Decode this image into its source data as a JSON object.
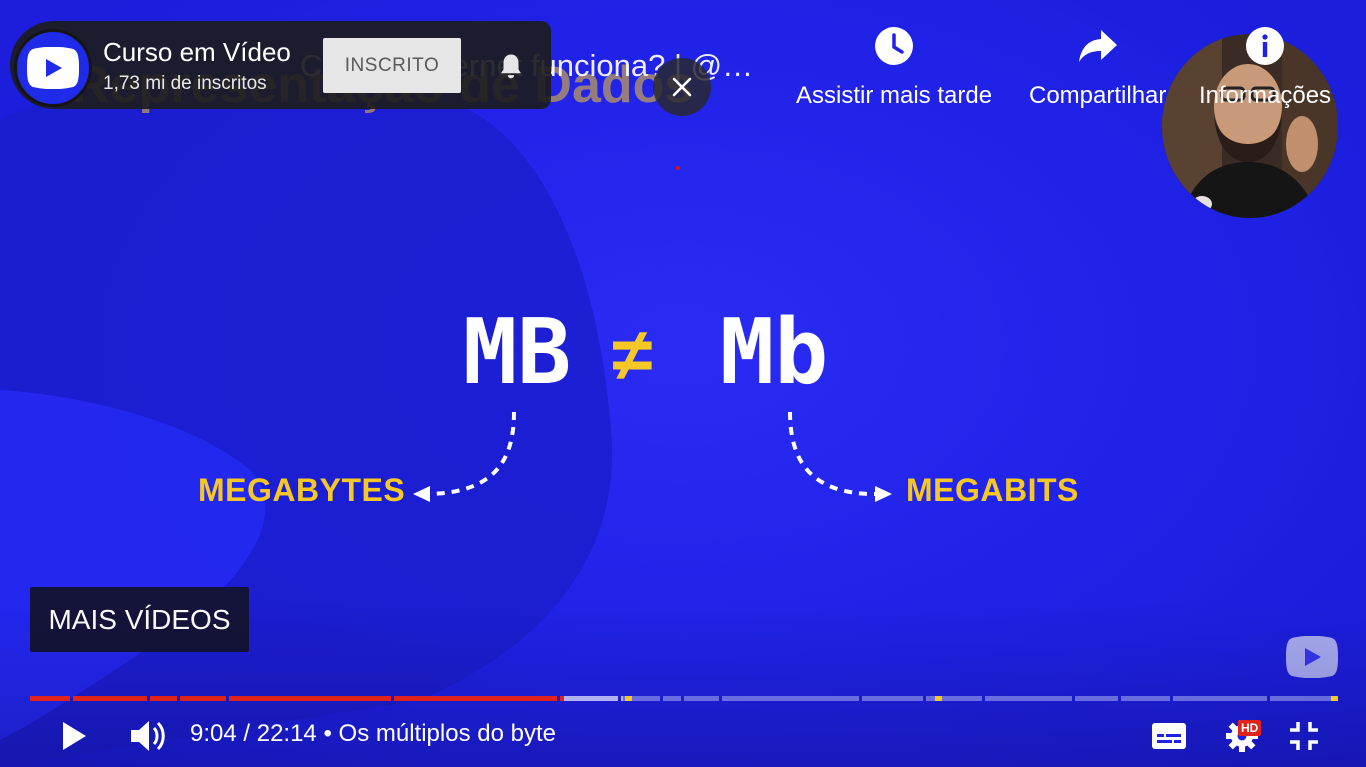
{
  "channel": {
    "name": "Curso em Vídeo",
    "subscribers": "1,73 mi de inscritos",
    "subscribe_label": "INSCRITO"
  },
  "video": {
    "title": "Como a Internet funciona? | @Curso em Ví…",
    "slide_title": "Representação de Dados"
  },
  "slide": {
    "left_symbol": "MB",
    "not_equal": "≠",
    "right_symbol": "Mb",
    "left_label": "MEGABYTES",
    "right_label": "MEGABITS",
    "accent_color": "#f5c825"
  },
  "actions": {
    "watch_later": "Assistir mais tarde",
    "share": "Compartilhar",
    "info": "Informações"
  },
  "more_videos_label": "MAIS VÍDEOS",
  "controls": {
    "time": "9:04 / 22:14",
    "chapter_separator": " • ",
    "chapter": "Os múltiplos do byte",
    "quality_badge": "HD"
  },
  "progress": {
    "played_fraction": 0.408,
    "buffered_fraction": 0.453,
    "played_color": "#e0231c",
    "chapters_count": 17
  },
  "icons": {
    "channel": "channel-logo-icon",
    "bell": "bell-icon",
    "close": "close-icon",
    "watch_later": "clock-icon",
    "share": "share-arrow-icon",
    "info": "info-icon",
    "play": "play-icon",
    "volume": "volume-icon",
    "captions": "subtitles-icon",
    "settings": "gear-icon",
    "exit_fullscreen": "exit-fullscreen-icon"
  }
}
